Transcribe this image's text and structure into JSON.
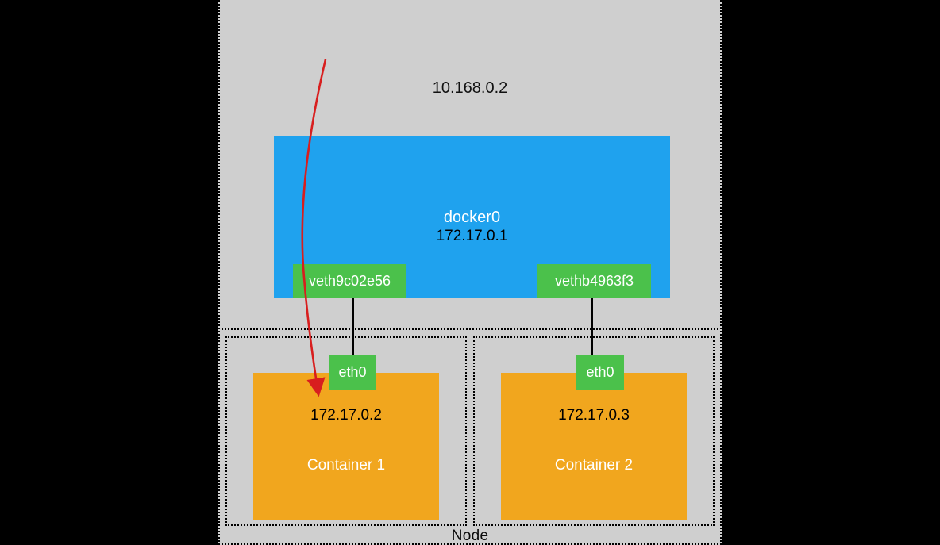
{
  "node": {
    "label": "Node",
    "host_ip": "10.168.0.2"
  },
  "bridge": {
    "name": "docker0",
    "ip": "172.17.0.1",
    "veth_left": "veth9c02e56",
    "veth_right": "vethb4963f3"
  },
  "containers": {
    "left": {
      "label": "Container 1",
      "iface": "eth0",
      "ip": "172.17.0.2"
    },
    "right": {
      "label": "Container  2",
      "iface": "eth0",
      "ip": "172.17.0.3"
    }
  },
  "arrow": {
    "meaning": "traffic-path-host-to-container1",
    "color": "#d81e1e"
  }
}
